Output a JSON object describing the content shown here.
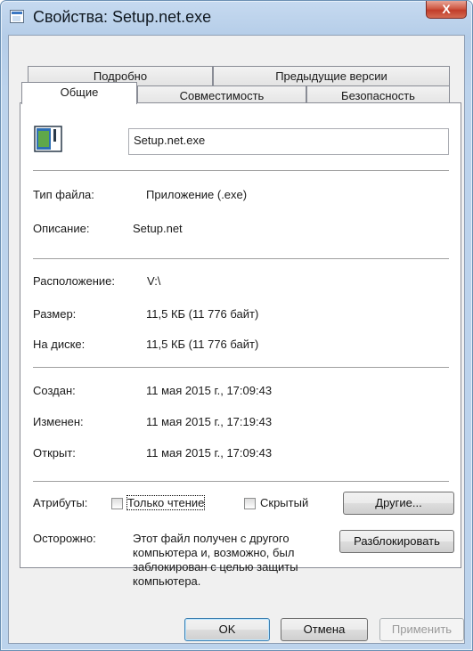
{
  "window": {
    "title": "Свойства: Setup.net.exe",
    "close_glyph": "X"
  },
  "tabs_row1": [
    "Подробно",
    "Предыдущие версии"
  ],
  "tabs_row2": [
    "Общие",
    "Совместимость",
    "Безопасность"
  ],
  "file": {
    "name": "Setup.net.exe",
    "icon": "application-icon"
  },
  "info": {
    "type_label": "Тип файла:",
    "type_value": "Приложение (.exe)",
    "desc_label": "Описание:",
    "desc_value": "Setup.net",
    "loc_label": "Расположение:",
    "loc_value": "V:\\",
    "size_label": "Размер:",
    "size_value": "11,5 КБ (11 776 байт)",
    "disk_label": "На диске:",
    "disk_value": "11,5 КБ (11 776 байт)",
    "created_label": "Создан:",
    "created_value": "11 мая 2015 г., 17:09:43",
    "modified_label": "Изменен:",
    "modified_value": "11 мая 2015 г., 17:19:43",
    "opened_label": "Открыт:",
    "opened_value": "11 мая 2015 г., 17:09:43"
  },
  "attributes": {
    "label": "Атрибуты:",
    "readonly_label": "Только чтение",
    "hidden_label": "Скрытый",
    "other_button": "Другие..."
  },
  "warning": {
    "label": "Осторожно:",
    "line1": "Этот файл получен с другого",
    "line2": "компьютера и, возможно, был",
    "line3": "заблокирован с целью защиты",
    "line4": "компьютера.",
    "unblock_button": "Разблокировать"
  },
  "buttons": {
    "ok": "OK",
    "cancel": "Отмена",
    "apply": "Применить"
  }
}
